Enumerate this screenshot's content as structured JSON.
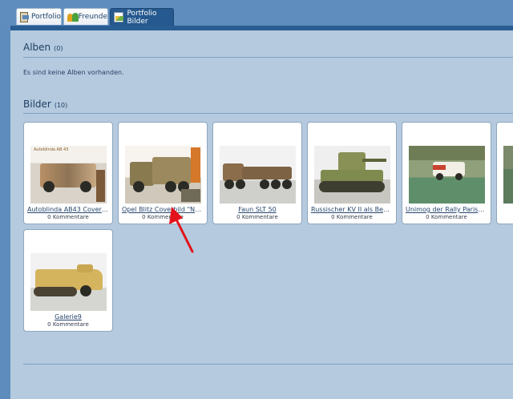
{
  "tabs": [
    {
      "label": "Portfolio",
      "icon": "portfolio-icon",
      "active": false
    },
    {
      "label": "Freunde",
      "icon": "friends-icon",
      "active": false
    },
    {
      "label": "Portfolio Bilder",
      "icon": "pictures-icon",
      "active": true
    }
  ],
  "albums": {
    "title": "Alben",
    "count": "(0)",
    "empty_message": "Es sind keine Alben vorhanden."
  },
  "pictures": {
    "title": "Bilder",
    "count": "(10)",
    "items": [
      {
        "title": "Autoblinda AB43 Coverbild",
        "comments": "0 Kommentare",
        "thumb_caption": "Autoblinda AB 43"
      },
      {
        "title": "Opel Blitz Coverbild \"Nac...",
        "comments": "0 Kommentare"
      },
      {
        "title": "Faun SLT 50",
        "comments": "0 Kommentare"
      },
      {
        "title": "Russischer KV II als Beut...",
        "comments": "0 Kommentare"
      },
      {
        "title": "Unimog der Rally Paris_D...",
        "comments": "0 Kommentare"
      },
      {
        "title": "Galerie9",
        "comments": "0 Kommentare"
      }
    ]
  },
  "colors": {
    "background": "#5e8dbd",
    "panel": "#b5cade",
    "active_tab": "#25598f",
    "arrow": "#e3121b"
  }
}
